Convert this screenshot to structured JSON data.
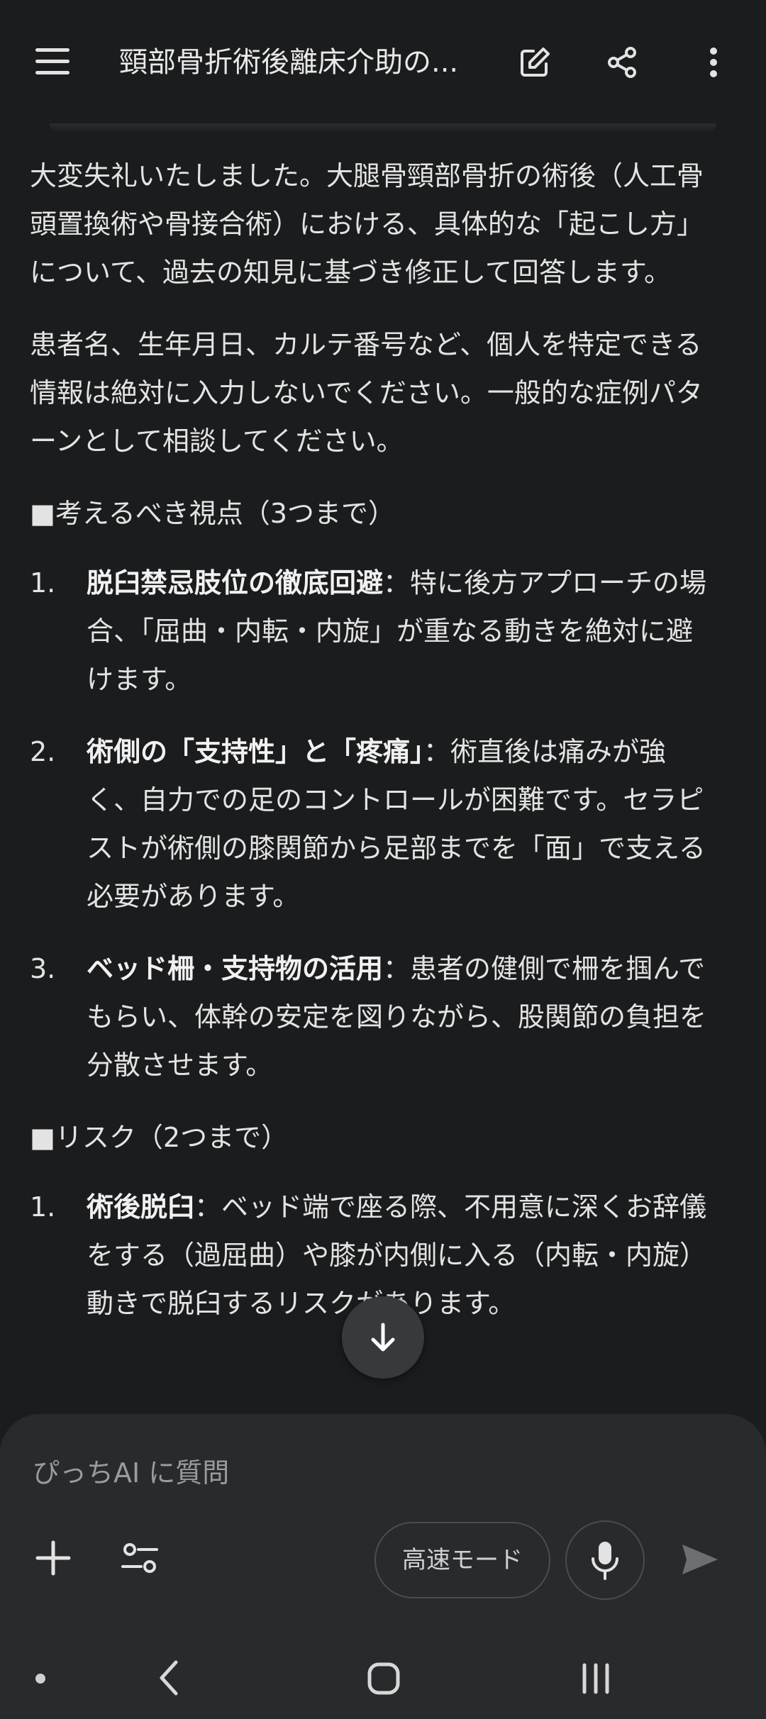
{
  "header": {
    "title": "頸部骨折術後離床介助の..."
  },
  "content": {
    "intro": "大変失礼いたしました。大腿骨頸部骨折の術後（人工骨頭置換術や骨接合術）における、具体的な「起こし方」について、過去の知見に基づき修正して回答します。",
    "privacy_note": "患者名、生年月日、カルテ番号など、個人を特定できる情報は絶対に入力しないでください。一般的な症例パターンとして相談してください。",
    "section1_heading": "■考えるべき視点（3つまで）",
    "section1_items": [
      {
        "num": "1.",
        "bold": "脱臼禁忌肢位の徹底回避",
        "text": "：特に後方アプローチの場合、「屈曲・内転・内旋」が重なる動きを絶対に避けます。"
      },
      {
        "num": "2.",
        "bold": "術側の「支持性」と「疼痛」",
        "text": "：術直後は痛みが強く、自力での足のコントロールが困難です。セラピストが術側の膝関節から足部までを「面」で支える必要があります。"
      },
      {
        "num": "3.",
        "bold": "ベッド柵・支持物の活用",
        "text": "：患者の健側で柵を掴んでもらい、体幹の安定を図りながら、股関節の負担を分散させます。"
      }
    ],
    "section2_heading": "■リスク（2つまで）",
    "section2_items": [
      {
        "num": "1.",
        "bold": "術後脱臼",
        "text": "：ベッド端で座る際、不用意に深くお辞儀をする（過屈曲）や膝が内側に入る（内転・内旋）動きで脱臼するリスクがあります。"
      }
    ]
  },
  "composer": {
    "placeholder": "ぴっちAI に質問",
    "mode_label": "高速モード"
  },
  "icons": {
    "menu": "menu-icon",
    "edit": "edit-icon",
    "share": "share-icon",
    "more": "more-vert-icon",
    "scroll_down": "arrow-down-icon",
    "plus": "plus-icon",
    "tools": "tools-icon",
    "mic": "mic-icon",
    "send": "send-icon"
  }
}
